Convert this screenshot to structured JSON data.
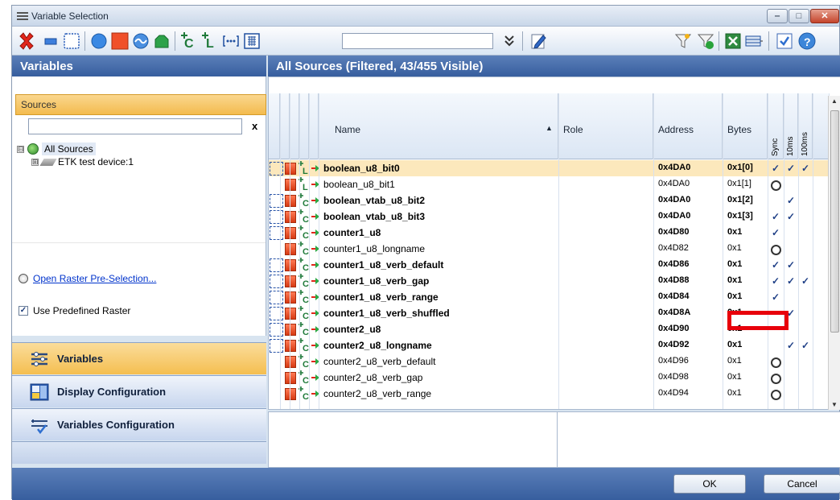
{
  "window": {
    "title": "Variable Selection",
    "title_icon": "list-icon",
    "controls": {
      "minimize": "‒",
      "maximize": "□",
      "close": "✕"
    }
  },
  "toolbar": {
    "search_value": "",
    "icons": [
      "delete-icon",
      "flat-rect-icon",
      "dotted-rect-icon",
      "blue-circle-icon",
      "red-square-icon",
      "blue-wave-icon",
      "green-shape-icon",
      "variable-c-icon",
      "variable-l-icon",
      "ellipsis-box-icon",
      "grid-box-icon",
      "double-chevron-icon",
      "edit-icon",
      "filter-icon",
      "filter-clear-icon",
      "excel-icon",
      "columns-icon",
      "check-box-icon",
      "help-icon"
    ]
  },
  "left": {
    "header": "Variables",
    "sources_label": "Sources",
    "search_value": "",
    "search_clear": "x",
    "tree": {
      "root": {
        "expander": "⊟",
        "label": "All Sources"
      },
      "child": {
        "expander": "⊞",
        "label": "ETK test device:1"
      }
    },
    "open_raster": "Open Raster Pre-Selection...",
    "use_predefined": {
      "label": "Use Predefined Raster",
      "checked": true,
      "mark": "✓"
    },
    "splitter_dots": ".........",
    "nav": [
      {
        "label": "Variables",
        "icon": "variables-icon"
      },
      {
        "label": "Display Configuration",
        "icon": "display-config-icon"
      },
      {
        "label": "Variables Configuration",
        "icon": "variables-config-icon"
      }
    ]
  },
  "right": {
    "header": "All Sources (Filtered, 43/455 Visible)",
    "columns": {
      "name": "Name",
      "sort": "▲",
      "role": "Role",
      "address": "Address",
      "bytes": "Bytes",
      "sync": "Sync",
      "ms10": "10ms",
      "ms100": "100ms"
    },
    "rows": [
      {
        "name": "boolean_u8_bit0",
        "address": "0x4DA0",
        "bytes": "0x1[0]",
        "bold": true,
        "selected": true,
        "boxed": true,
        "vtype": "L",
        "sync": "✓",
        "ms10": "✓",
        "ms100": "✓"
      },
      {
        "name": "boolean_u8_bit1",
        "address": "0x4DA0",
        "bytes": "0x1[1]",
        "bold": false,
        "selected": false,
        "boxed": false,
        "vtype": "L",
        "sync": "○",
        "ms10": "",
        "ms100": ""
      },
      {
        "name": "boolean_vtab_u8_bit2",
        "address": "0x4DA0",
        "bytes": "0x1[2]",
        "bold": true,
        "selected": false,
        "boxed": true,
        "vtype": "C",
        "sync": "",
        "ms10": "✓",
        "ms100": ""
      },
      {
        "name": "boolean_vtab_u8_bit3",
        "address": "0x4DA0",
        "bytes": "0x1[3]",
        "bold": true,
        "selected": false,
        "boxed": true,
        "vtype": "C",
        "sync": "✓",
        "ms10": "✓",
        "ms100": ""
      },
      {
        "name": "counter1_u8",
        "address": "0x4D80",
        "bytes": "0x1",
        "bold": true,
        "selected": false,
        "boxed": true,
        "vtype": "C",
        "sync": "✓",
        "ms10": "",
        "ms100": ""
      },
      {
        "name": "counter1_u8_longname",
        "address": "0x4D82",
        "bytes": "0x1",
        "bold": false,
        "selected": false,
        "boxed": false,
        "vtype": "C",
        "sync": "○",
        "ms10": "",
        "ms100": ""
      },
      {
        "name": "counter1_u8_verb_default",
        "address": "0x4D86",
        "bytes": "0x1",
        "bold": true,
        "selected": false,
        "boxed": true,
        "vtype": "C",
        "sync": "✓",
        "ms10": "✓",
        "ms100": ""
      },
      {
        "name": "counter1_u8_verb_gap",
        "address": "0x4D88",
        "bytes": "0x1",
        "bold": true,
        "selected": false,
        "boxed": true,
        "vtype": "C",
        "sync": "✓",
        "ms10": "✓",
        "ms100": "✓"
      },
      {
        "name": "counter1_u8_verb_range",
        "address": "0x4D84",
        "bytes": "0x1",
        "bold": true,
        "selected": false,
        "boxed": true,
        "vtype": "C",
        "sync": "✓",
        "ms10": "",
        "ms100": ""
      },
      {
        "name": "counter1_u8_verb_shuffled",
        "address": "0x4D8A",
        "bytes": "0x1",
        "bold": true,
        "selected": false,
        "boxed": true,
        "vtype": "C",
        "sync": "",
        "ms10": "✓",
        "ms100": ""
      },
      {
        "name": "counter2_u8",
        "address": "0x4D90",
        "bytes": "0x1",
        "bold": true,
        "selected": false,
        "boxed": true,
        "vtype": "C",
        "sync": "",
        "ms10": "",
        "ms100": ""
      },
      {
        "name": "counter2_u8_longname",
        "address": "0x4D92",
        "bytes": "0x1",
        "bold": true,
        "selected": false,
        "boxed": true,
        "vtype": "C",
        "sync": "",
        "ms10": "✓",
        "ms100": "✓"
      },
      {
        "name": "counter2_u8_verb_default",
        "address": "0x4D96",
        "bytes": "0x1",
        "bold": false,
        "selected": false,
        "boxed": false,
        "vtype": "C",
        "sync": "○",
        "ms10": "",
        "ms100": ""
      },
      {
        "name": "counter2_u8_verb_gap",
        "address": "0x4D98",
        "bytes": "0x1",
        "bold": false,
        "selected": false,
        "boxed": false,
        "vtype": "C",
        "sync": "○",
        "ms10": "",
        "ms100": ""
      },
      {
        "name": "counter2_u8_verb_range",
        "address": "0x4D94",
        "bytes": "0x1",
        "bold": false,
        "selected": false,
        "boxed": false,
        "vtype": "C",
        "sync": "○",
        "ms10": "",
        "ms100": ""
      }
    ]
  },
  "footer": {
    "ok": "OK",
    "cancel": "Cancel"
  },
  "colors": {
    "header_blue": "#375e9e",
    "selected_row": "#fce8bc",
    "accent_orange": "#f3bb4e",
    "highlight_red": "#e8000b"
  }
}
